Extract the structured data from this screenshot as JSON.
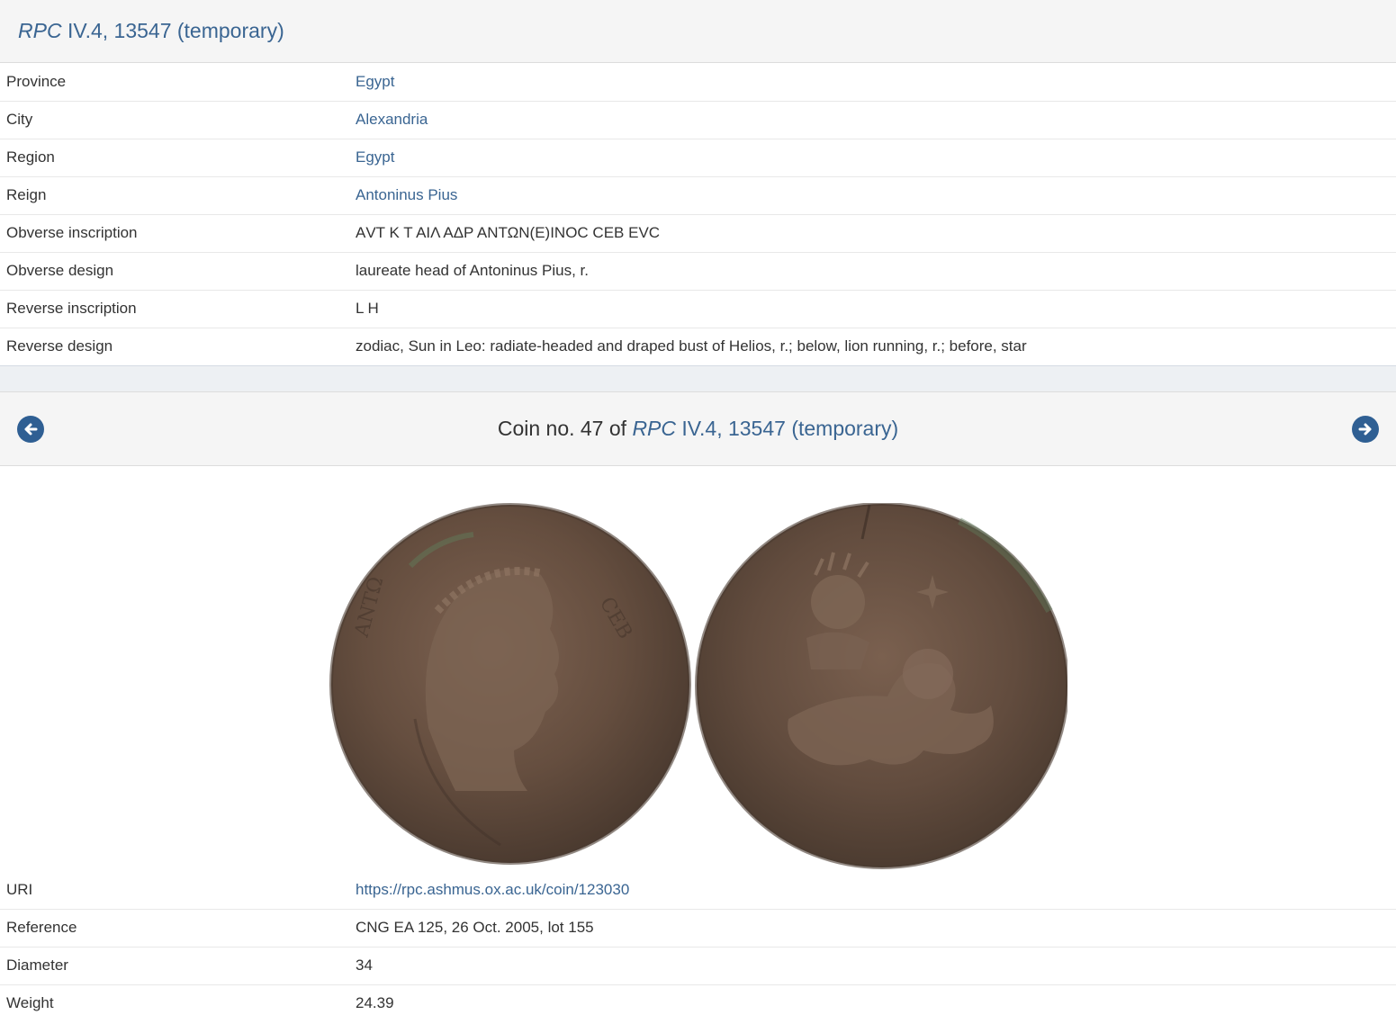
{
  "header": {
    "title_italic": "RPC",
    "title_rest": " IV.4, 13547 (temporary)"
  },
  "type_details": [
    {
      "label": "Province",
      "value": "Egypt",
      "link": true
    },
    {
      "label": "City",
      "value": "Alexandria",
      "link": true
    },
    {
      "label": "Region",
      "value": "Egypt",
      "link": true
    },
    {
      "label": "Reign",
      "value": "Antoninus Pius",
      "link": true
    },
    {
      "label": "Obverse inscription",
      "value": "ΑVΤ Κ Τ ΑΙΛ ΑΔΡ ΑΝΤΩΝ(Ε)ΙΝΟϹ ϹΕΒ ΕVϹ",
      "link": false
    },
    {
      "label": "Obverse design",
      "value": "laureate head of Antoninus Pius, r.",
      "link": false
    },
    {
      "label": "Reverse inscription",
      "value": "L H",
      "link": false
    },
    {
      "label": "Reverse design",
      "value": "zodiac, Sun in Leo: radiate-headed and draped bust of Helios, r.; below, lion running, r.; before, star",
      "link": false
    }
  ],
  "coin_nav": {
    "prefix": "Coin no. 47 of ",
    "rpc_italic": "RPC",
    "rpc_rest": " IV.4, 13547 (temporary)",
    "prev_icon": "arrow-circle-left-icon",
    "next_icon": "arrow-circle-right-icon"
  },
  "coin_details": [
    {
      "label": "URI",
      "value": "https://rpc.ashmus.ox.ac.uk/coin/123030",
      "link": true
    },
    {
      "label": "Reference",
      "value": "CNG EA 125, 26 Oct. 2005, lot 155",
      "link": false
    },
    {
      "label": "Diameter",
      "value": "34",
      "link": false
    },
    {
      "label": "Weight",
      "value": "24.39",
      "link": false
    }
  ],
  "colors": {
    "link": "#3a6592",
    "text": "#333333",
    "header_bg": "#f5f5f5",
    "nav_button": "#2f5f93",
    "coin_bronze": "#6e5645"
  }
}
